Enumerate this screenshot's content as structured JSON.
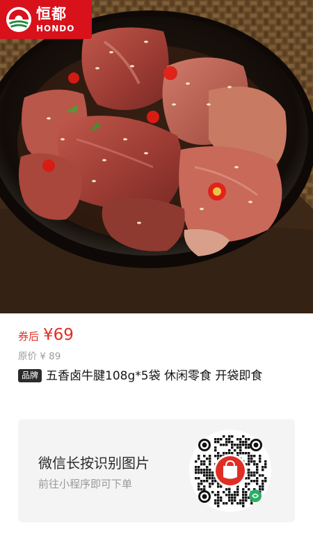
{
  "brand": {
    "name_cn": "恒都",
    "name_en": "HONDO"
  },
  "product": {
    "coupon_label": "券后",
    "price": "¥69",
    "original_price": "原价 ¥ 89",
    "badge": "品牌",
    "title": "五香卤牛腱108g*5袋 休闲零食 开袋即食"
  },
  "mini_program": {
    "title": "微信长按识别图片",
    "subtitle": "前往小程序即可下单"
  },
  "colors": {
    "accent": "#e02e24",
    "logo_red": "#d8111b",
    "card_bg": "#f4f4f4"
  }
}
